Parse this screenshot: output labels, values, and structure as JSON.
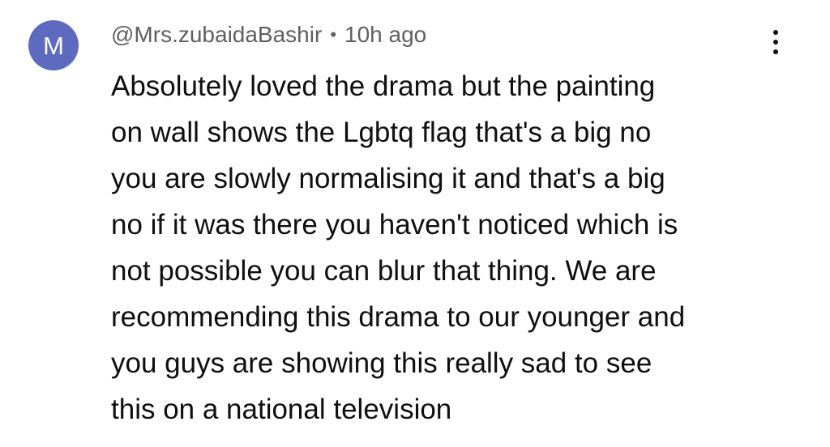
{
  "comment": {
    "avatar_letter": "M",
    "avatar_color": "#5c6bc0",
    "author": "@Mrs.zubaidaBashir",
    "separator": "•",
    "time": "10h ago",
    "more_icon": "vertical-ellipsis-icon",
    "lines": [
      "Absolutely loved the drama but the painting",
      "on wall shows the Lgbtq flag that's a big no",
      "you are slowly normalising it and that's a big",
      "no if it was there you haven't noticed which is",
      "not possible you can blur that thing. We are",
      "recommending this drama to our younger and",
      "you guys are showing this really sad to see",
      "this on a national television"
    ]
  }
}
